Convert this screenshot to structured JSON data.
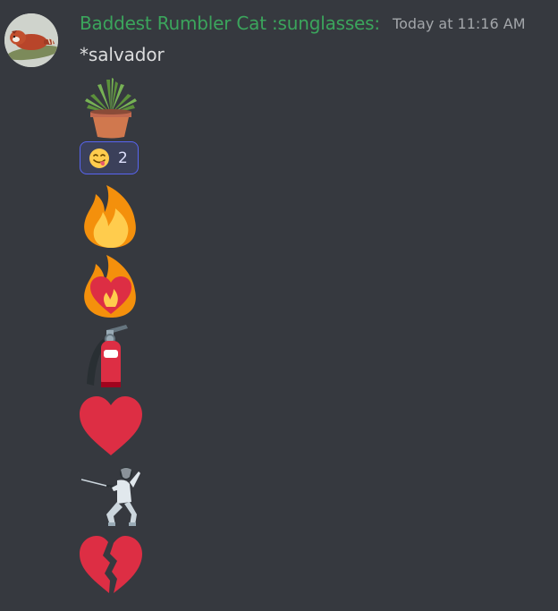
{
  "message": {
    "author": "Baddest Rumbler Cat :sunglasses:",
    "author_color": "#3ba55c",
    "timestamp": "Today at 11:16 AM",
    "text": "*salvador"
  },
  "emojis": [
    {
      "icon": "potted-plant"
    },
    {
      "icon": "fire"
    },
    {
      "icon": "heart-on-fire"
    },
    {
      "icon": "fire-extinguisher"
    },
    {
      "icon": "red-heart"
    },
    {
      "icon": "person-fencing"
    },
    {
      "icon": "broken-heart"
    }
  ],
  "reaction": {
    "icon": "face-savoring-food",
    "count": "2",
    "accent": "#5865f2"
  },
  "colors": {
    "background": "#36393f",
    "text": "#dcddde",
    "timestamp": "#a3a6aa"
  }
}
